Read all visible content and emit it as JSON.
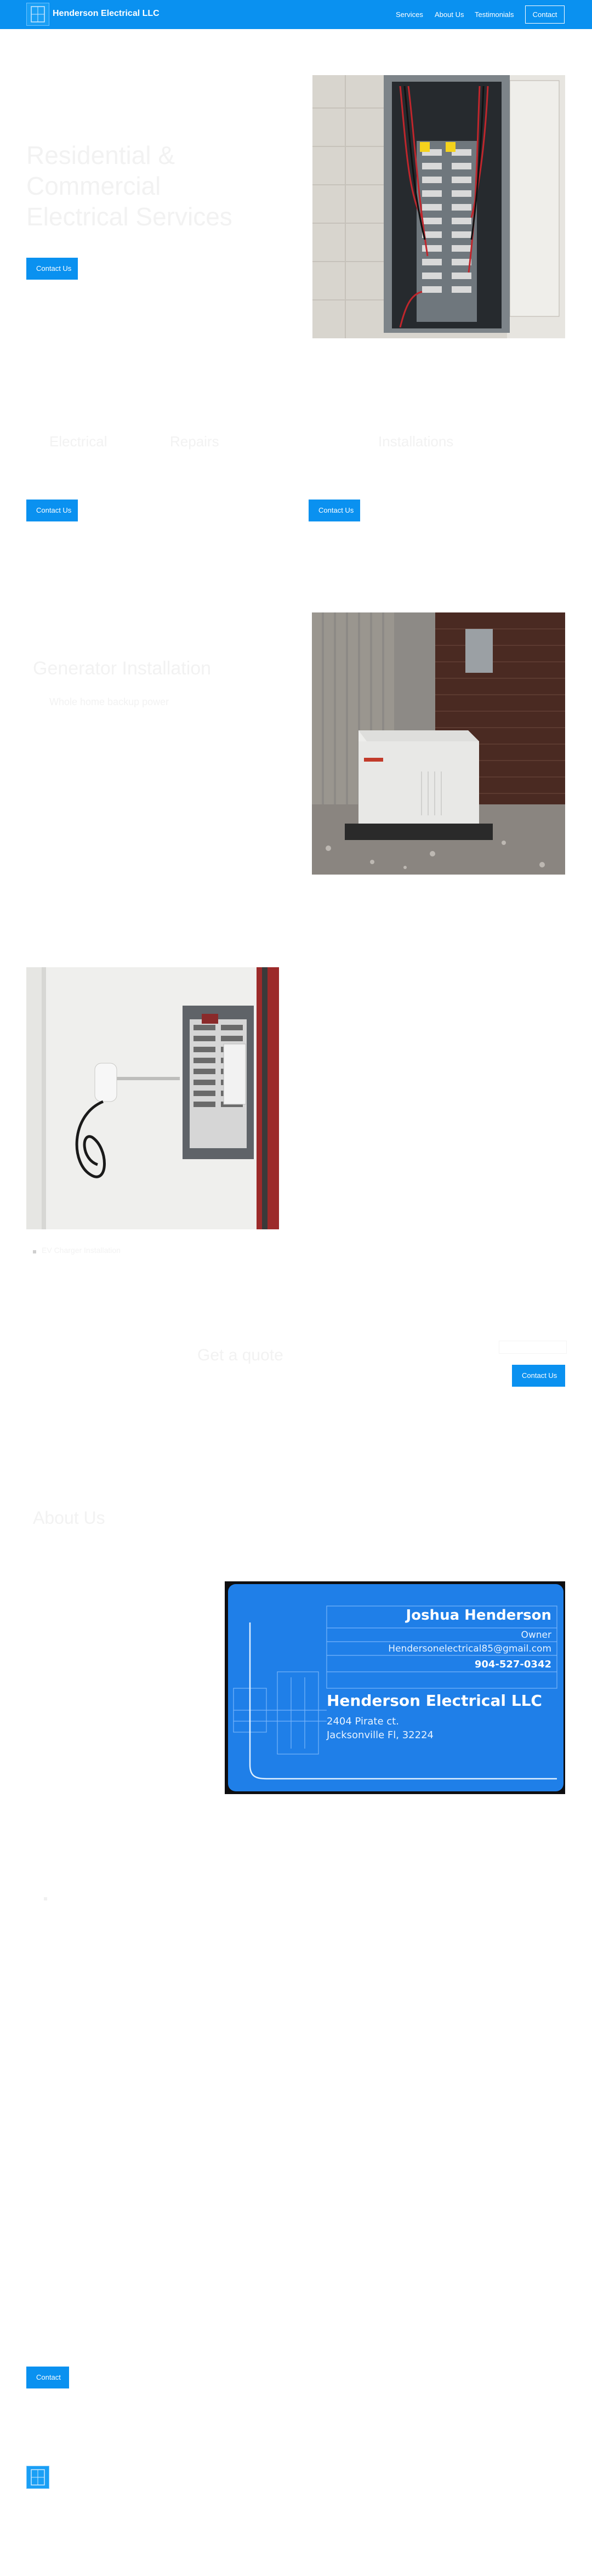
{
  "nav": {
    "brand": "Henderson Electrical LLC",
    "links": [
      "Services",
      "About Us",
      "Testimonials"
    ],
    "contact_label": "Contact"
  },
  "hero": {
    "heading_line1": "Residential & Commercial",
    "heading_line2": "Electrical Services",
    "cta": "Contact Us"
  },
  "services": {
    "left_label": "Electrical",
    "mid_label": "Repairs",
    "right_label": "Installations",
    "cta_left": "Contact Us",
    "cta_right": "Contact Us"
  },
  "generator": {
    "heading": "Generator Installation",
    "sub": "Whole home backup power"
  },
  "ev": {
    "caption": "EV Charger Installation"
  },
  "mid_cta": {
    "text": "Get a quote",
    "cta": "Contact Us"
  },
  "about": {
    "heading": "About Us"
  },
  "card": {
    "name": "Joshua Henderson",
    "title": "Owner",
    "email": "Hendersonelectrical85@gmail.com",
    "phone": "904-527-0342",
    "company": "Henderson Electrical LLC",
    "address1": "2404 Pirate ct.",
    "address2": "Jacksonville Fl, 32224"
  },
  "footer": {
    "contact_label": "Contact"
  },
  "colors": {
    "primary": "#0a91f0",
    "card_bg": "#1f7fe8"
  }
}
